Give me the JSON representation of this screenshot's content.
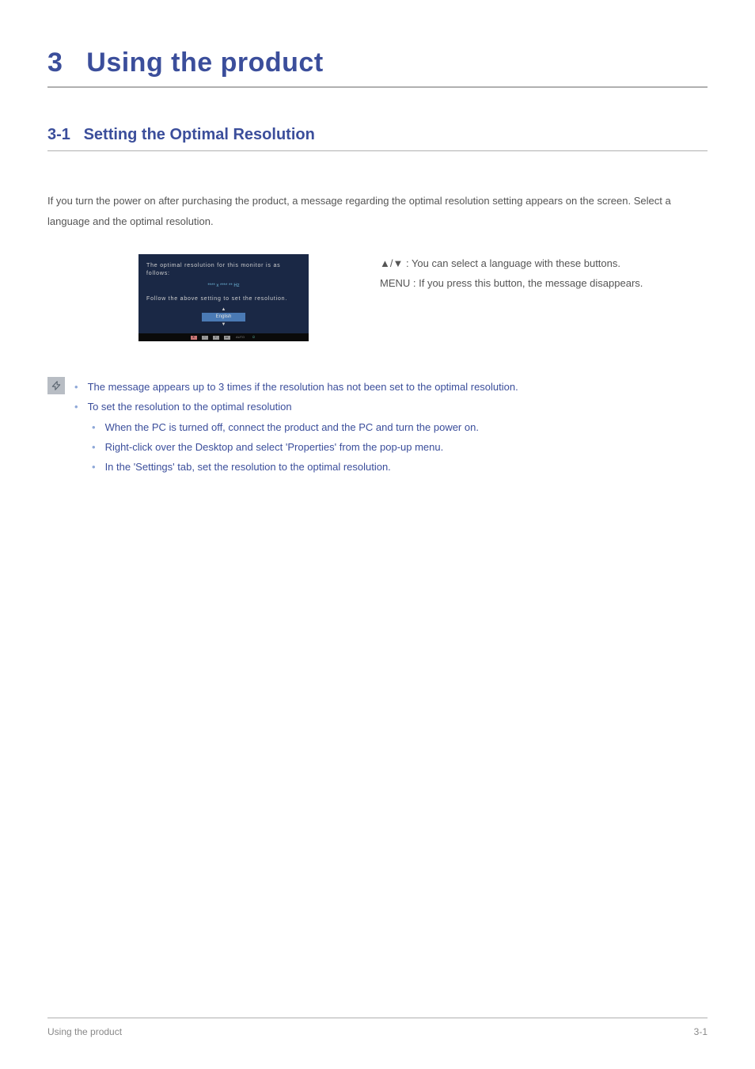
{
  "chapter": {
    "number": "3",
    "title": "Using the product"
  },
  "section": {
    "number": "3-1",
    "title": "Setting the Optimal Resolution"
  },
  "intro": "If you turn the power on after purchasing the product, a message regarding the optimal resolution setting appears on the screen. Select a language and the optimal resolution.",
  "osd": {
    "line1": "The optimal resolution for this monitor is as follows:",
    "resolution": "**** x **** ** Hz",
    "line2": "Follow the above setting to set the resolution.",
    "language": "English",
    "auto_label": "AUTO"
  },
  "buttons": {
    "arrows": "▲/▼ : You can select a language with these buttons.",
    "menu": "MENU : If you press this button, the message disappears."
  },
  "notes": {
    "item1": "The message appears up to 3 times if the resolution has not been set to the optimal resolution.",
    "item2": "To set the resolution to the optimal resolution",
    "sub1": "When the PC is turned off, connect the product and the PC and turn the power on.",
    "sub2": "Right-click over the Desktop and select 'Properties' from the pop-up menu.",
    "sub3": "In the 'Settings' tab, set the resolution to the optimal resolution."
  },
  "footer": {
    "left": "Using the product",
    "right": "3-1"
  }
}
